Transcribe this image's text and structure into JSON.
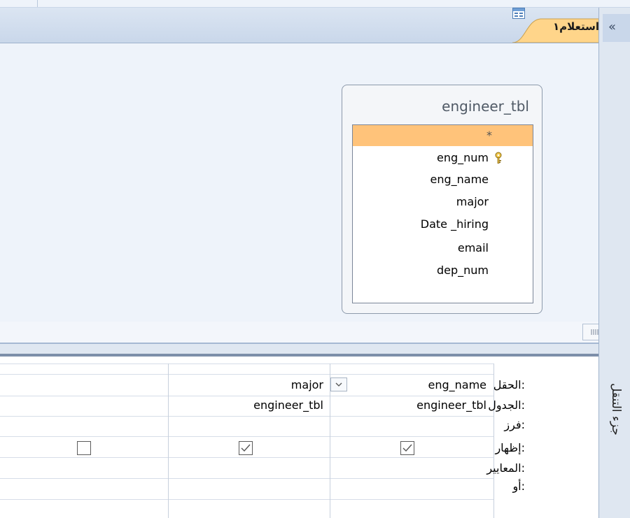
{
  "tab": {
    "title": "استعلام١",
    "icon": "query-icon"
  },
  "table_box": {
    "name": "engineer_tbl",
    "fields": [
      "*",
      "eng_num",
      "eng_name",
      "major",
      "Date _hiring",
      "email",
      "dep_num"
    ],
    "primary_key_field": "eng_num",
    "selected_field": "*"
  },
  "grid": {
    "row_labels": [
      "الحقل:",
      "الجدول:",
      "فرز:",
      "إظهار:",
      "المعايير:",
      "أو:"
    ],
    "columns": [
      {
        "field": "eng_name",
        "table": "engineer_tbl",
        "show": true,
        "has_dropdown": true
      },
      {
        "field": "major",
        "table": "engineer_tbl",
        "show": true,
        "has_dropdown": false
      },
      {
        "field": "",
        "table": "",
        "show": false,
        "has_dropdown": false
      }
    ]
  },
  "nav_pane": {
    "label": "جزء التنقل",
    "collapse_icon": "chevron-double-left-icon"
  },
  "colors": {
    "selected_row": "#ffc37a",
    "tab": "#ffd58a",
    "pane": "#dfe7f1"
  }
}
